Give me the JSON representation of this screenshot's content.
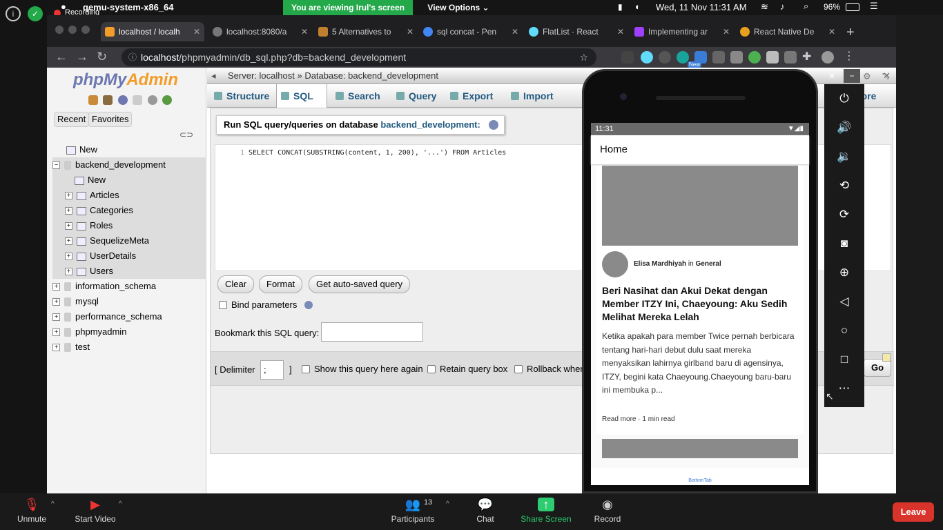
{
  "menubar": {
    "app_name": "qemu-system-x86_64",
    "recording": "Recording",
    "viewing_banner": "You are viewing Irul's screen",
    "view_options": "View Options",
    "datetime": "Wed, 11 Nov 11:31 AM",
    "battery": "96%"
  },
  "chrome": {
    "tabs": [
      {
        "title": "localhost / localh",
        "fav_color": "#f29d2a"
      },
      {
        "title": "localhost:8080/a",
        "fav_color": "#777777"
      },
      {
        "title": "5 Alternatives to",
        "fav_color": "#c08030"
      },
      {
        "title": "sql concat - Pen",
        "fav_color": "#4285f4"
      },
      {
        "title": "FlatList · React",
        "fav_color": "#61dafb"
      },
      {
        "title": "Implementing ar",
        "fav_color": "#a040ff"
      },
      {
        "title": "React Native De",
        "fav_color": "#e8a020"
      }
    ],
    "url_host": "localhost",
    "url_path": "/phpmyadmin/db_sql.php?db=backend_development",
    "new_badge": "New"
  },
  "pma": {
    "logo_php": "php",
    "logo_my": "My",
    "logo_admin": "Admin",
    "recent": "Recent",
    "favorites": "Favorites",
    "tree": {
      "new_top": "New",
      "db": "backend_development",
      "new_db": "New",
      "tables": [
        "Articles",
        "Categories",
        "Roles",
        "SequelizeMeta",
        "UserDetails",
        "Users"
      ],
      "other_dbs": [
        "information_schema",
        "mysql",
        "performance_schema",
        "phpmyadmin",
        "test"
      ]
    },
    "breadcrumb_server": "Server: localhost",
    "breadcrumb_sep": "»",
    "breadcrumb_db": "Database: backend_development",
    "tabs": [
      "Structure",
      "SQL",
      "Search",
      "Query",
      "Export",
      "Import"
    ],
    "more": "More",
    "run_title_prefix": "Run SQL query/queries on database",
    "run_title_db": "backend_development:",
    "line_no": "1",
    "sql": "SELECT CONCAT(SUBSTRING(content, 1, 200), '...') FROM Articles",
    "btn_clear": "Clear",
    "btn_format": "Format",
    "btn_autosaved": "Get auto-saved query",
    "bind_params": "Bind parameters",
    "bookmark_label": "Bookmark this SQL query:",
    "delimiter_label": "[ Delimiter",
    "delimiter_value": ";",
    "delimiter_close": "]",
    "show_again": "Show this query here again",
    "retain_box": "Retain query box",
    "rollback": "Rollback wher",
    "go": "Go"
  },
  "phone": {
    "time": "11:31",
    "app_title": "Home",
    "author": "Elisa Mardhiyah",
    "in_word": "in",
    "category": "General",
    "headline": "Beri Nasihat dan Akui Dekat dengan Member ITZY Ini, Chaeyoung: Aku Sedih Melihat Mereka Lelah",
    "excerpt": "Ketika apakah para member Twice pernah berbicara tentang hari-hari debut dulu saat mereka menyaksikan lahirnya girlband baru di agensinya, ITZY, begini kata Chaeyoung.Chaeyoung baru-baru ini membuka p...",
    "read_more": "Read more",
    "read_time": "1 min read",
    "bottom_tab": "BottomTab"
  },
  "zoom": {
    "unmute": "Unmute",
    "start_video": "Start Video",
    "participants_count": "13",
    "participants": "Participants",
    "chat": "Chat",
    "share_screen": "Share Screen",
    "record": "Record",
    "leave": "Leave"
  }
}
